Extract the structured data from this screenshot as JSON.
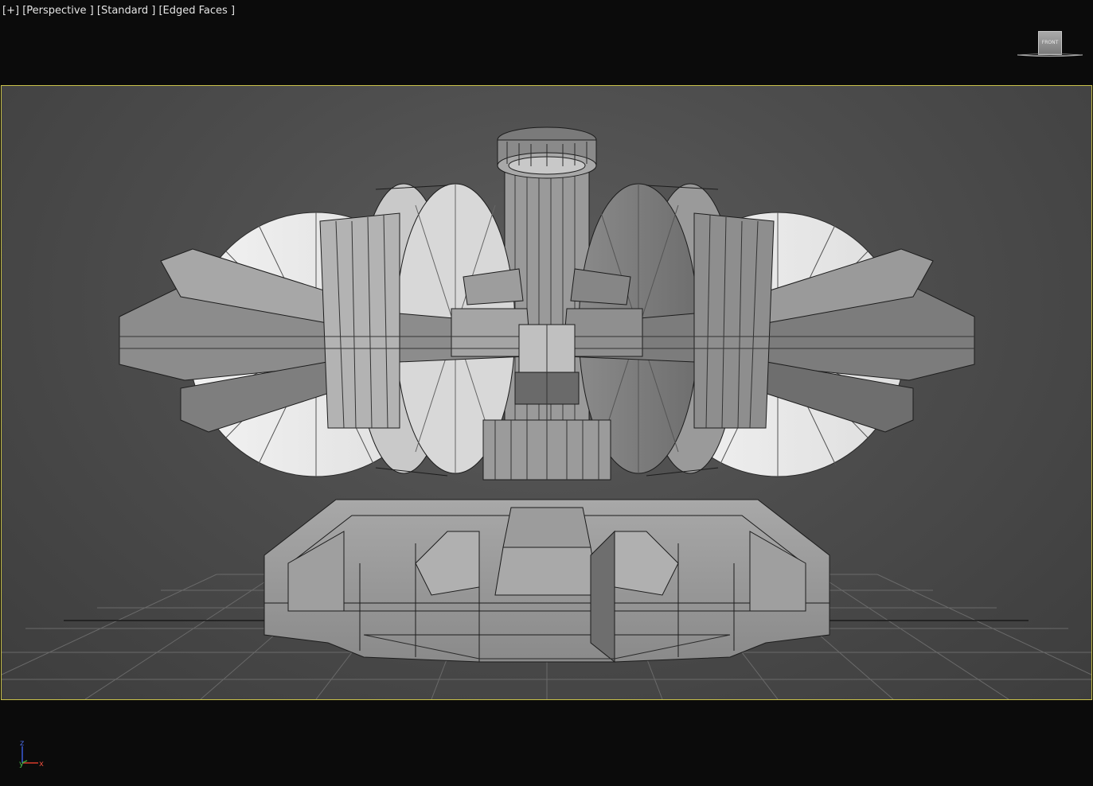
{
  "viewport": {
    "label_plus": "[+]",
    "label_view": "[Perspective ]",
    "label_shading": "[Standard ]",
    "label_display": "[Edged Faces ]"
  },
  "viewcube": {
    "face_label": "FRONT"
  },
  "axis_tripod": {
    "z": "z",
    "y": "y",
    "x": "x"
  },
  "colors": {
    "background": "#0b0b0b",
    "viewport_bg": "#4a4a4a",
    "safe_frame": "#c8c04a",
    "grid": "#6d6d6d",
    "mesh_fill": "#9a9a9a",
    "mesh_edge": "#1c1c1c",
    "axis_x": "#d83a2a",
    "axis_y": "#3aa83a",
    "axis_z": "#3a5ad8"
  },
  "icons": [
    "viewcube-icon",
    "axis-tripod-icon"
  ]
}
